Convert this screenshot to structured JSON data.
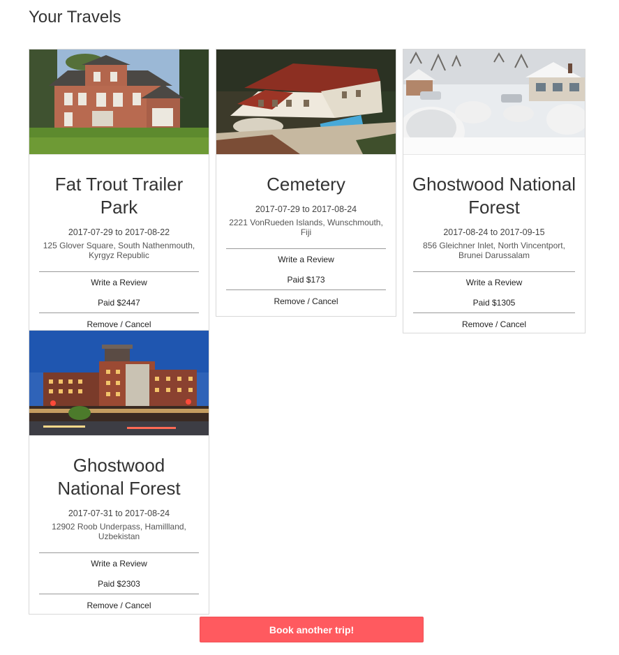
{
  "page": {
    "title": "Your Travels"
  },
  "trips": [
    {
      "name": "Fat Trout Trailer Park",
      "dates": "2017-07-29 to 2017-08-22",
      "address": "125 Glover Square, South Nathenmouth, Kyrgyz Republic",
      "review_label": "Write a Review",
      "paid": "Paid $2447",
      "remove_label": "Remove / Cancel"
    },
    {
      "name": "Cemetery",
      "dates": "2017-07-29 to 2017-08-24",
      "address": "2221 VonRueden Islands, Wunschmouth, Fiji",
      "review_label": "Write a Review",
      "paid": "Paid $173",
      "remove_label": "Remove / Cancel"
    },
    {
      "name": "Ghostwood National Forest",
      "dates": "2017-08-24 to 2017-09-15",
      "address": "856 Gleichner Inlet, North Vincentport, Brunei Darussalam",
      "review_label": "Write a Review",
      "paid": "Paid $1305",
      "remove_label": "Remove / Cancel"
    },
    {
      "name": "Ghostwood National Forest",
      "dates": "2017-07-31 to 2017-08-24",
      "address": "12902 Roob Underpass, Hamillland, Uzbekistan",
      "review_label": "Write a Review",
      "paid": "Paid $2303",
      "remove_label": "Remove / Cancel"
    }
  ],
  "cta": {
    "label": "Book another trip!"
  },
  "colors": {
    "accent": "#ff5a5f",
    "border": "#d8d8d8",
    "text": "#333333"
  }
}
